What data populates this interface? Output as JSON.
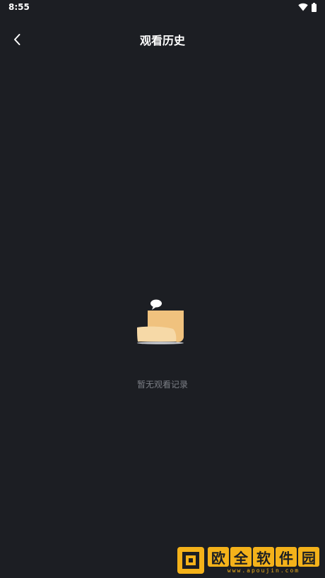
{
  "status_bar": {
    "time": "8:55",
    "icons": [
      "wifi-icon",
      "battery-icon"
    ]
  },
  "header": {
    "title": "观看历史",
    "back_icon": "chevron-left-icon"
  },
  "empty_state": {
    "message": "暂无观看记录",
    "illustration": "empty-scroll-icon"
  },
  "watermark": {
    "chars": [
      "欧",
      "全",
      "软",
      "件",
      "园"
    ],
    "url": "www.apoujin.com"
  },
  "colors": {
    "background": "#1c1e23",
    "text_primary": "#ffffff",
    "text_secondary": "#7c7f86",
    "illustration": "#f2c98a",
    "watermark": "#f4b21a"
  }
}
